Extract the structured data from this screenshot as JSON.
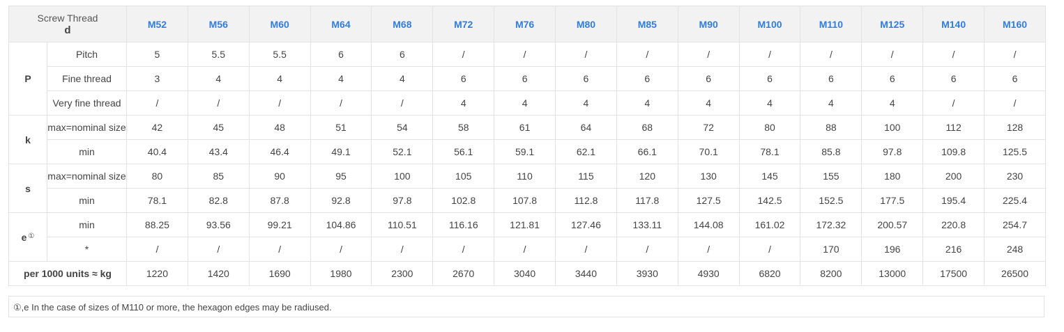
{
  "table": {
    "corner_title": "Screw Thread",
    "corner_symbol": "d",
    "sizes": [
      "M52",
      "M56",
      "M60",
      "M64",
      "M68",
      "M72",
      "M76",
      "M80",
      "M85",
      "M90",
      "M100",
      "M110",
      "M125",
      "M140",
      "M160"
    ],
    "groups": [
      {
        "label": "P",
        "marker": "",
        "rows": [
          {
            "sub": "Pitch",
            "values": [
              "5",
              "5.5",
              "5.5",
              "6",
              "6",
              "/",
              "/",
              "/",
              "/",
              "/",
              "/",
              "/",
              "/",
              "/",
              "/"
            ]
          },
          {
            "sub": "Fine thread",
            "values": [
              "3",
              "4",
              "4",
              "4",
              "4",
              "6",
              "6",
              "6",
              "6",
              "6",
              "6",
              "6",
              "6",
              "6",
              "6"
            ]
          },
          {
            "sub": "Very fine thread",
            "values": [
              "/",
              "/",
              "/",
              "/",
              "/",
              "4",
              "4",
              "4",
              "4",
              "4",
              "4",
              "4",
              "4",
              "/",
              "/"
            ]
          }
        ]
      },
      {
        "label": "k",
        "marker": "",
        "rows": [
          {
            "sub": "max=nominal size",
            "values": [
              "42",
              "45",
              "48",
              "51",
              "54",
              "58",
              "61",
              "64",
              "68",
              "72",
              "80",
              "88",
              "100",
              "112",
              "128"
            ]
          },
          {
            "sub": "min",
            "values": [
              "40.4",
              "43.4",
              "46.4",
              "49.1",
              "52.1",
              "56.1",
              "59.1",
              "62.1",
              "66.1",
              "70.1",
              "78.1",
              "85.8",
              "97.8",
              "109.8",
              "125.5"
            ]
          }
        ]
      },
      {
        "label": "s",
        "marker": "",
        "rows": [
          {
            "sub": "max=nominal size",
            "values": [
              "80",
              "85",
              "90",
              "95",
              "100",
              "105",
              "110",
              "115",
              "120",
              "130",
              "145",
              "155",
              "180",
              "200",
              "230"
            ]
          },
          {
            "sub": "min",
            "values": [
              "78.1",
              "82.8",
              "87.8",
              "92.8",
              "97.8",
              "102.8",
              "107.8",
              "112.8",
              "117.8",
              "127.5",
              "142.5",
              "152.5",
              "177.5",
              "195.4",
              "225.4"
            ]
          }
        ]
      },
      {
        "label": "e",
        "marker": "①",
        "rows": [
          {
            "sub": "min",
            "values": [
              "88.25",
              "93.56",
              "99.21",
              "104.86",
              "110.51",
              "116.16",
              "121.81",
              "127.46",
              "133.11",
              "144.08",
              "161.02",
              "172.32",
              "200.57",
              "220.8",
              "254.7"
            ]
          },
          {
            "sub": "*",
            "values": [
              "/",
              "/",
              "/",
              "/",
              "/",
              "/",
              "/",
              "/",
              "/",
              "/",
              "/",
              "170",
              "196",
              "216",
              "248"
            ]
          }
        ]
      }
    ],
    "weight_label": "per 1000 units ≈ kg",
    "weights": [
      "1220",
      "1420",
      "1690",
      "1980",
      "2300",
      "2670",
      "3040",
      "3440",
      "3930",
      "4930",
      "6820",
      "8200",
      "13000",
      "17500",
      "26500"
    ]
  },
  "note": "①,e In the case of sizes of M110 or more, the hexagon edges may be radiused."
}
